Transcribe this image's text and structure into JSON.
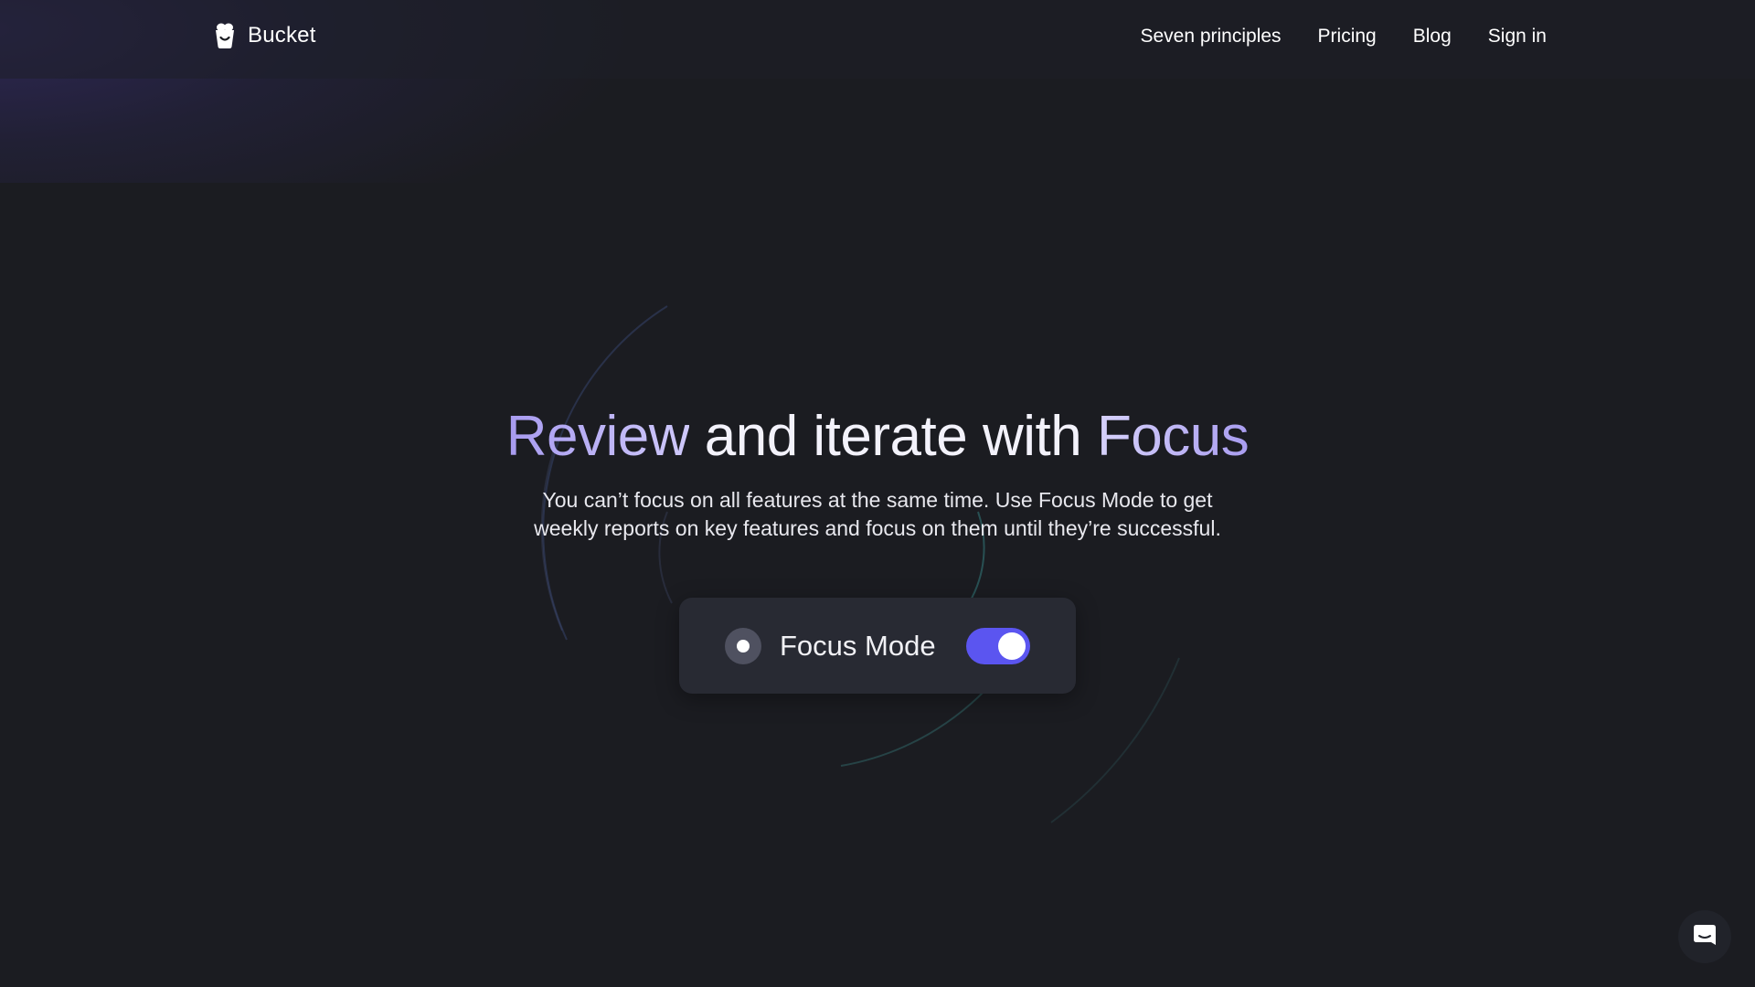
{
  "header": {
    "logo_text": "Bucket",
    "nav": [
      {
        "label": "Seven principles"
      },
      {
        "label": "Pricing"
      },
      {
        "label": "Blog"
      },
      {
        "label": "Sign in"
      }
    ]
  },
  "hero": {
    "title_part1": "Review",
    "title_part2": " and iterate with ",
    "title_part3": "Focus",
    "subtitle_line1": "You can’t focus on all features at the same time. Use Focus Mode to get",
    "subtitle_line2": "weekly reports on key features and focus on them until they’re successful."
  },
  "focus_card": {
    "label": "Focus Mode",
    "toggle_on": true
  },
  "colors": {
    "background": "#1b1c21",
    "card": "#282a33",
    "accent": "#5b55f0",
    "title_gradient_start": "#a89bf0"
  },
  "icons": {
    "logo": "bucket-logo-icon",
    "chat": "chat-bubble-icon"
  }
}
